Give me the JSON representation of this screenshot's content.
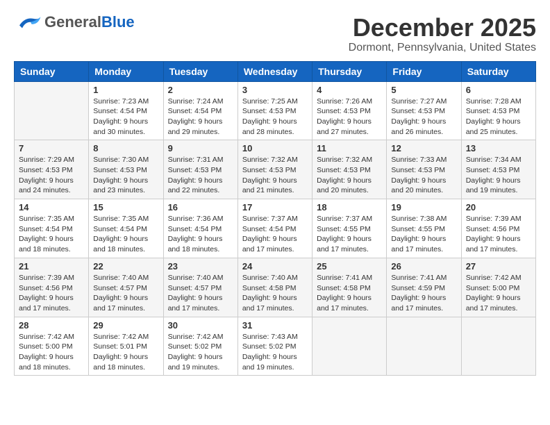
{
  "header": {
    "logo_general": "General",
    "logo_blue": "Blue",
    "month_title": "December 2025",
    "location": "Dormont, Pennsylvania, United States"
  },
  "days_of_week": [
    "Sunday",
    "Monday",
    "Tuesday",
    "Wednesday",
    "Thursday",
    "Friday",
    "Saturday"
  ],
  "weeks": [
    [
      {
        "day": "",
        "info": ""
      },
      {
        "day": "1",
        "info": "Sunrise: 7:23 AM\nSunset: 4:54 PM\nDaylight: 9 hours\nand 30 minutes."
      },
      {
        "day": "2",
        "info": "Sunrise: 7:24 AM\nSunset: 4:54 PM\nDaylight: 9 hours\nand 29 minutes."
      },
      {
        "day": "3",
        "info": "Sunrise: 7:25 AM\nSunset: 4:53 PM\nDaylight: 9 hours\nand 28 minutes."
      },
      {
        "day": "4",
        "info": "Sunrise: 7:26 AM\nSunset: 4:53 PM\nDaylight: 9 hours\nand 27 minutes."
      },
      {
        "day": "5",
        "info": "Sunrise: 7:27 AM\nSunset: 4:53 PM\nDaylight: 9 hours\nand 26 minutes."
      },
      {
        "day": "6",
        "info": "Sunrise: 7:28 AM\nSunset: 4:53 PM\nDaylight: 9 hours\nand 25 minutes."
      }
    ],
    [
      {
        "day": "7",
        "info": "Sunrise: 7:29 AM\nSunset: 4:53 PM\nDaylight: 9 hours\nand 24 minutes."
      },
      {
        "day": "8",
        "info": "Sunrise: 7:30 AM\nSunset: 4:53 PM\nDaylight: 9 hours\nand 23 minutes."
      },
      {
        "day": "9",
        "info": "Sunrise: 7:31 AM\nSunset: 4:53 PM\nDaylight: 9 hours\nand 22 minutes."
      },
      {
        "day": "10",
        "info": "Sunrise: 7:32 AM\nSunset: 4:53 PM\nDaylight: 9 hours\nand 21 minutes."
      },
      {
        "day": "11",
        "info": "Sunrise: 7:32 AM\nSunset: 4:53 PM\nDaylight: 9 hours\nand 20 minutes."
      },
      {
        "day": "12",
        "info": "Sunrise: 7:33 AM\nSunset: 4:53 PM\nDaylight: 9 hours\nand 20 minutes."
      },
      {
        "day": "13",
        "info": "Sunrise: 7:34 AM\nSunset: 4:53 PM\nDaylight: 9 hours\nand 19 minutes."
      }
    ],
    [
      {
        "day": "14",
        "info": "Sunrise: 7:35 AM\nSunset: 4:54 PM\nDaylight: 9 hours\nand 18 minutes."
      },
      {
        "day": "15",
        "info": "Sunrise: 7:35 AM\nSunset: 4:54 PM\nDaylight: 9 hours\nand 18 minutes."
      },
      {
        "day": "16",
        "info": "Sunrise: 7:36 AM\nSunset: 4:54 PM\nDaylight: 9 hours\nand 18 minutes."
      },
      {
        "day": "17",
        "info": "Sunrise: 7:37 AM\nSunset: 4:54 PM\nDaylight: 9 hours\nand 17 minutes."
      },
      {
        "day": "18",
        "info": "Sunrise: 7:37 AM\nSunset: 4:55 PM\nDaylight: 9 hours\nand 17 minutes."
      },
      {
        "day": "19",
        "info": "Sunrise: 7:38 AM\nSunset: 4:55 PM\nDaylight: 9 hours\nand 17 minutes."
      },
      {
        "day": "20",
        "info": "Sunrise: 7:39 AM\nSunset: 4:56 PM\nDaylight: 9 hours\nand 17 minutes."
      }
    ],
    [
      {
        "day": "21",
        "info": "Sunrise: 7:39 AM\nSunset: 4:56 PM\nDaylight: 9 hours\nand 17 minutes."
      },
      {
        "day": "22",
        "info": "Sunrise: 7:40 AM\nSunset: 4:57 PM\nDaylight: 9 hours\nand 17 minutes."
      },
      {
        "day": "23",
        "info": "Sunrise: 7:40 AM\nSunset: 4:57 PM\nDaylight: 9 hours\nand 17 minutes."
      },
      {
        "day": "24",
        "info": "Sunrise: 7:40 AM\nSunset: 4:58 PM\nDaylight: 9 hours\nand 17 minutes."
      },
      {
        "day": "25",
        "info": "Sunrise: 7:41 AM\nSunset: 4:58 PM\nDaylight: 9 hours\nand 17 minutes."
      },
      {
        "day": "26",
        "info": "Sunrise: 7:41 AM\nSunset: 4:59 PM\nDaylight: 9 hours\nand 17 minutes."
      },
      {
        "day": "27",
        "info": "Sunrise: 7:42 AM\nSunset: 5:00 PM\nDaylight: 9 hours\nand 17 minutes."
      }
    ],
    [
      {
        "day": "28",
        "info": "Sunrise: 7:42 AM\nSunset: 5:00 PM\nDaylight: 9 hours\nand 18 minutes."
      },
      {
        "day": "29",
        "info": "Sunrise: 7:42 AM\nSunset: 5:01 PM\nDaylight: 9 hours\nand 18 minutes."
      },
      {
        "day": "30",
        "info": "Sunrise: 7:42 AM\nSunset: 5:02 PM\nDaylight: 9 hours\nand 19 minutes."
      },
      {
        "day": "31",
        "info": "Sunrise: 7:43 AM\nSunset: 5:02 PM\nDaylight: 9 hours\nand 19 minutes."
      },
      {
        "day": "",
        "info": ""
      },
      {
        "day": "",
        "info": ""
      },
      {
        "day": "",
        "info": ""
      }
    ]
  ]
}
